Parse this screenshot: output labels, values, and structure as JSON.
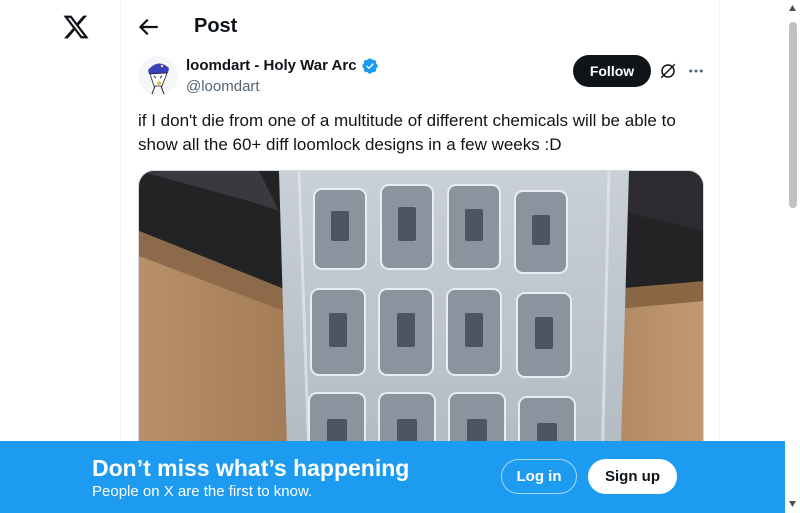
{
  "header": {
    "title": "Post"
  },
  "post": {
    "author": {
      "display_name": "loomdart - Holy War Arc",
      "handle": "@loomdart",
      "verified": true
    },
    "follow_label": "Follow",
    "text": "if I don't die from one of a multitude of different chemicals will be able to show all the 60+ diff loomlock designs in a few weeks :D"
  },
  "bottom_bar": {
    "title": "Don’t miss what’s happening",
    "subtitle": "People on X are the first to know.",
    "login_label": "Log in",
    "signup_label": "Sign up"
  },
  "icons": {
    "logo": "x-logo-icon",
    "back": "arrow-left-icon",
    "verified": "verified-badge-icon",
    "grok": "grok-icon",
    "more": "more-horizontal-icon"
  },
  "colors": {
    "accent": "#1d9bf0",
    "text": "#0f1419",
    "secondary_text": "#536471"
  }
}
